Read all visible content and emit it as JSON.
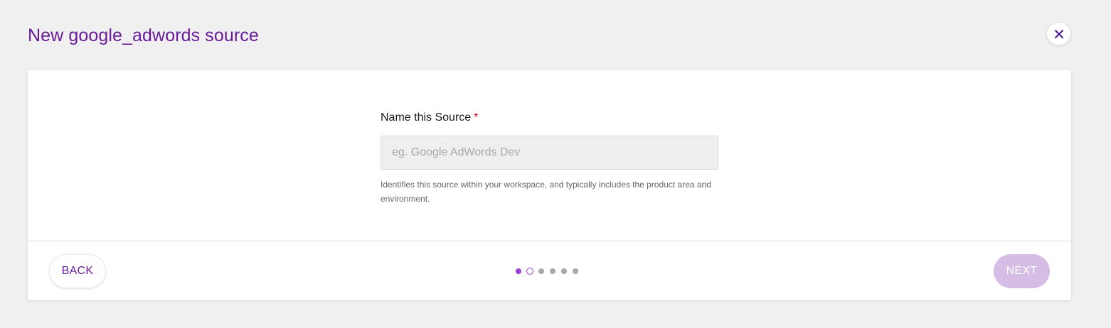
{
  "modal": {
    "title": "New google_adwords source",
    "close_icon": "close-icon"
  },
  "form": {
    "label": "Name this Source",
    "required_marker": "*",
    "input": {
      "value": "",
      "placeholder": "eg. Google AdWords Dev"
    },
    "help": "Identifies this source within your workspace, and typically includes the product area and environment."
  },
  "footer": {
    "back_label": "BACK",
    "next_label": "NEXT",
    "steps": {
      "total": 6,
      "current": 2,
      "states": [
        "done",
        "current",
        "todo",
        "todo",
        "todo",
        "todo"
      ]
    }
  },
  "colors": {
    "accent": "#6a1b9a",
    "step_active": "#9c3fd6",
    "next_disabled": "#d6bde6",
    "required": "#d0021b"
  }
}
